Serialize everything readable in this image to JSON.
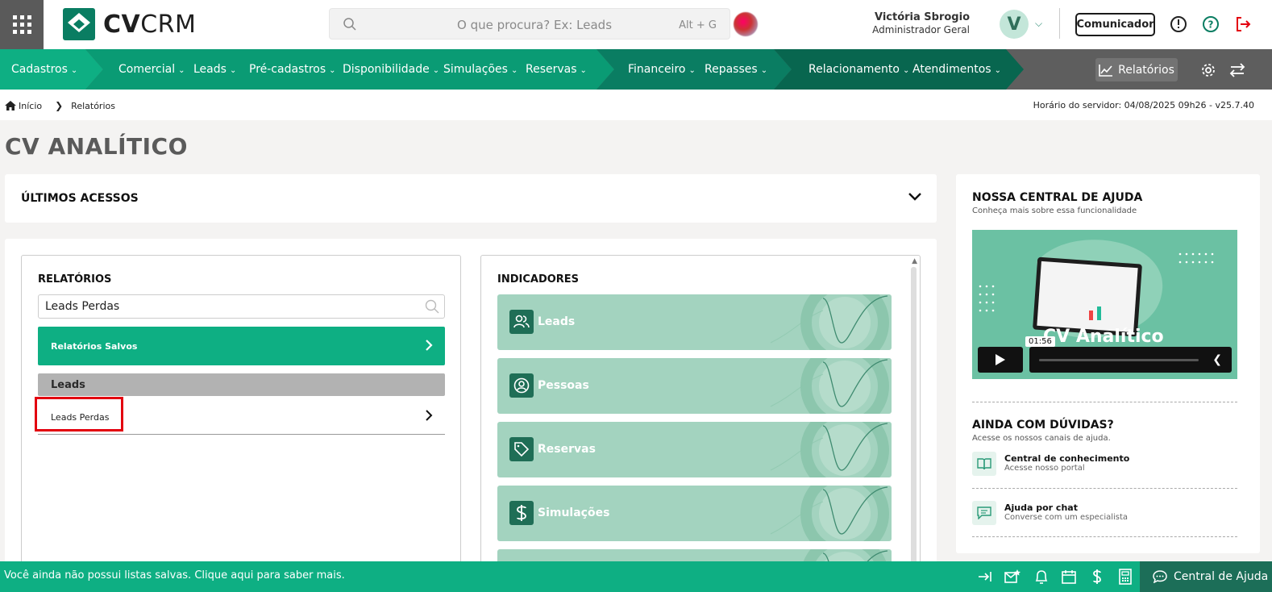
{
  "header": {
    "logo_bold": "CV",
    "logo_light": "CRM",
    "search_placeholder": "O que procura? Ex: Leads",
    "search_shortcut": "Alt + G",
    "user_name": "Victória Sbrogio",
    "user_role": "Administrador Geral",
    "avatar_letter": "V",
    "comunicador_label": "Comunicador"
  },
  "nav": {
    "items": [
      "Cadastros",
      "Comercial",
      "Leads",
      "Pré-cadastros",
      "Disponibilidade",
      "Simulações",
      "Reservas",
      "Financeiro",
      "Repasses",
      "Relacionamento",
      "Atendimentos"
    ],
    "relatorios_label": "Relatórios",
    "colors": {
      "teal": "#0eaf83",
      "dark_teal": "#0a7d62",
      "darker_teal": "#08664f",
      "gray": "#5e5e5e"
    }
  },
  "breadcrumb": {
    "home": "Início",
    "current": "Relatórios",
    "server_time": "Horário do servidor: 04/08/2025 09h26 - v25.7.40"
  },
  "page_title": "CV ANALÍTICO",
  "ultimos": {
    "title": "ÚLTIMOS ACESSOS"
  },
  "relatorios": {
    "title": "RELATÓRIOS",
    "search_value": "Leads Perdas",
    "saved_label": "Relatórios Salvos",
    "group_label": "Leads",
    "item_label": "Leads Perdas"
  },
  "indicadores": {
    "title": "INDICADORES",
    "cards": [
      "Leads",
      "Pessoas",
      "Reservas",
      "Simulações"
    ]
  },
  "help": {
    "title": "NOSSA CENTRAL DE AJUDA",
    "subtitle": "Conheça mais sobre essa funcionalidade",
    "video_title": "CV Analítico",
    "video_time": "01:56",
    "ainda_title": "AINDA COM DÚVIDAS?",
    "ainda_sub": "Acesse os nossos canais de ajuda.",
    "channels": [
      {
        "title": "Central de conhecimento",
        "sub": "Acesse nosso portal"
      },
      {
        "title": "Ajuda por chat",
        "sub": "Converse com um especialista"
      }
    ]
  },
  "footer": {
    "message": "Você ainda não possui listas salvas. Clique aqui para saber mais.",
    "help_label": "Central de Ajuda"
  }
}
